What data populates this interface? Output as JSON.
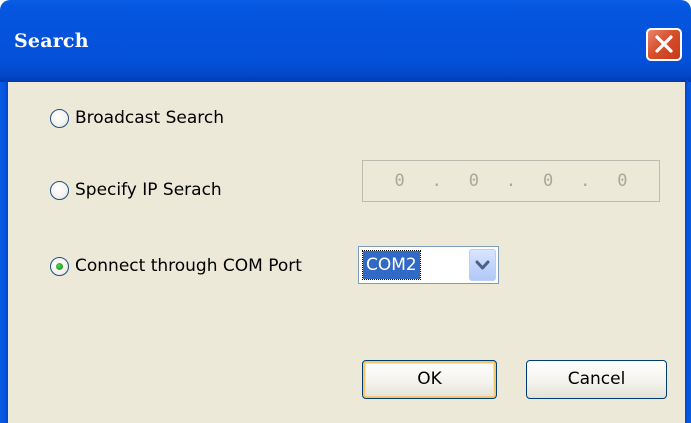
{
  "window": {
    "title": "Search",
    "close_icon": "close-icon"
  },
  "options": {
    "broadcast": {
      "label": "Broadcast Search",
      "checked": false
    },
    "specify_ip": {
      "label": "Specify IP Serach",
      "checked": false
    },
    "com_port": {
      "label": "Connect through COM Port",
      "checked": true
    }
  },
  "ip_address": {
    "octets": [
      "0",
      "0",
      "0",
      "0"
    ],
    "enabled": false
  },
  "com_select": {
    "value": "COM2",
    "dropdown_icon": "chevron-down-icon"
  },
  "buttons": {
    "ok": "OK",
    "cancel": "Cancel"
  },
  "colors": {
    "titlebar": "#0553dd",
    "client": "#ece9d8",
    "close": "#d8502c",
    "selection": "#316ac5"
  }
}
